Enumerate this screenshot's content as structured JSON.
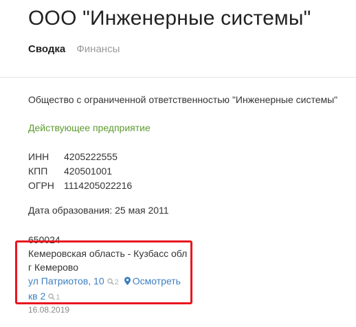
{
  "header": {
    "title": "ООО \"Инженерные системы\"",
    "tabs": [
      {
        "label": "Сводка",
        "active": true
      },
      {
        "label": "Финансы",
        "active": false
      }
    ]
  },
  "company": {
    "full_name": "Общество с ограниченной ответственностью \"Инженерные системы\"",
    "status": "Действующее предприятие",
    "status_color": "#5c9a2f",
    "requisites": [
      {
        "label": "ИНН",
        "value": "4205222555"
      },
      {
        "label": "КПП",
        "value": "420501001"
      },
      {
        "label": "ОГРН",
        "value": "1114205022216"
      }
    ],
    "founded": "Дата образования: 25 мая 2011"
  },
  "address": {
    "postal_code": "650024",
    "region": "Кемеровская область - Кузбасс обл",
    "city": "г Кемерово",
    "street": "ул Патриотов, 10",
    "street_count": "2",
    "map_link": "Осмотреть",
    "apartment": "кв 2",
    "apartment_count": "1",
    "link_color": "#3d7fc0"
  },
  "footer": {
    "date": "16.08.2019"
  },
  "highlight": {
    "color": "#e8141e"
  }
}
